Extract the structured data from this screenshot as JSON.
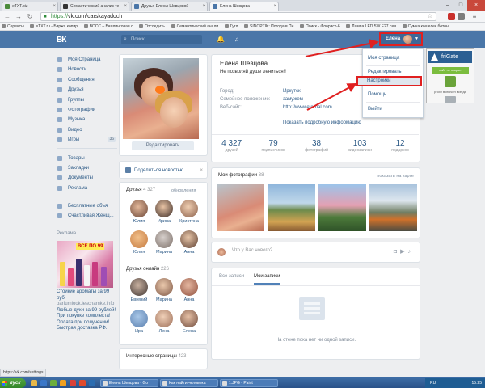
{
  "browser": {
    "tabs": [
      {
        "label": "eTXT.biz",
        "color": "#4b8b3b"
      },
      {
        "label": "Семантический анализ те",
        "color": "#333333"
      },
      {
        "label": "Друзья Елены Шевцовой",
        "color": "#4a76a8"
      },
      {
        "label": "Елена Шевцова",
        "color": "#4a76a8"
      }
    ],
    "url_scheme": "https://",
    "url_rest": "vk.com/carskayadoch",
    "bookmarks": [
      "Сервисы",
      "eTXT.ru - Биржа копир",
      "ВОСС – Биллинговая с",
      "Отследить",
      "Семантический анали",
      "Гугл",
      "SINOPTIK: Погода в Пи",
      "Поиск - Флорист-6",
      "Лампа LED 5W E27 сея",
      "Сумка кошелек ботон"
    ],
    "status_url": "https://vk.com/settings"
  },
  "vk": {
    "logo": "ВК",
    "search_placeholder": "Поиск",
    "user_name": "Елена",
    "menu": [
      {
        "label": "Моя Страница"
      },
      {
        "label": "Новости"
      },
      {
        "label": "Сообщения"
      },
      {
        "label": "Друзья"
      },
      {
        "label": "Группы"
      },
      {
        "label": "Фотографии"
      },
      {
        "label": "Музыка"
      },
      {
        "label": "Видео"
      },
      {
        "label": "Игры",
        "count": "36"
      }
    ],
    "menu2": [
      {
        "label": "Товары"
      },
      {
        "label": "Закладки"
      },
      {
        "label": "Документы"
      },
      {
        "label": "Реклама"
      }
    ],
    "menu3": [
      {
        "label": "Бесплатные объя"
      },
      {
        "label": "Счастливая Женщ..."
      }
    ],
    "ad": {
      "label": "Реклама",
      "sale": "ВСЕ ПО 99",
      "title": "Стойкие ароматы за 99 руб!",
      "domain": "parfumlook.leschamke.info",
      "body": "Любые духи за 99 рублей!При покупке комплекта! Оплата при получении! Быстрая доставка РФ."
    },
    "profile": {
      "name": "Елена Шевцова",
      "status": "Не позволяй душе лениться!!",
      "edit_button": "Редактировать",
      "fields": [
        {
          "label": "Город:",
          "value": "Иркутск"
        },
        {
          "label": "Семейное положение:",
          "value": "замужем"
        },
        {
          "label": "Веб-сайт:",
          "value": "http://www.eternal.com"
        }
      ],
      "more_link": "Показать подробную информацию",
      "counters": [
        {
          "n": "4 327",
          "l": "друзей"
        },
        {
          "n": "79",
          "l": "подписчиков"
        },
        {
          "n": "38",
          "l": "фотографий"
        },
        {
          "n": "103",
          "l": "видеозаписи"
        },
        {
          "n": "12",
          "l": "подарков"
        }
      ]
    },
    "news_button": "Поделиться новостью",
    "friends": {
      "title": "Друзья",
      "count": "4 327",
      "right": "обновления",
      "items": [
        "Юлия",
        "Ирина",
        "Кристина",
        "Юлия",
        "Марина",
        "Анна"
      ]
    },
    "friends_online": {
      "title": "Друзья онлайн",
      "count": "226",
      "items": [
        "Евгений",
        "Марина",
        "Анна",
        "Ира",
        "Лена",
        "Елена"
      ]
    },
    "interesting": {
      "title": "Интересные страницы",
      "count": "423"
    },
    "photos": {
      "title": "Мои фотографии",
      "count": "38",
      "right": "показать на карте"
    },
    "composer_placeholder": "Что у Вас нового?",
    "wall": {
      "tab_all": "Все записи",
      "tab_mine": "Мои записи",
      "empty": "На стене пока нет ни одной записи."
    },
    "dropdown": [
      "Моя страница",
      "Редактировать",
      "Настройки",
      "Помощь",
      "Выйти"
    ]
  },
  "frigate": {
    "title": "friGate",
    "site_btn": "сайт не открыт",
    "adv": "proxy включен всегда"
  },
  "taskbar": {
    "start": "пуск",
    "tasks": [
      "Елена Шевцова - Go",
      "Как найти человека",
      "1.JPG - Paint"
    ],
    "lang": "RU",
    "clock": "15:25"
  }
}
